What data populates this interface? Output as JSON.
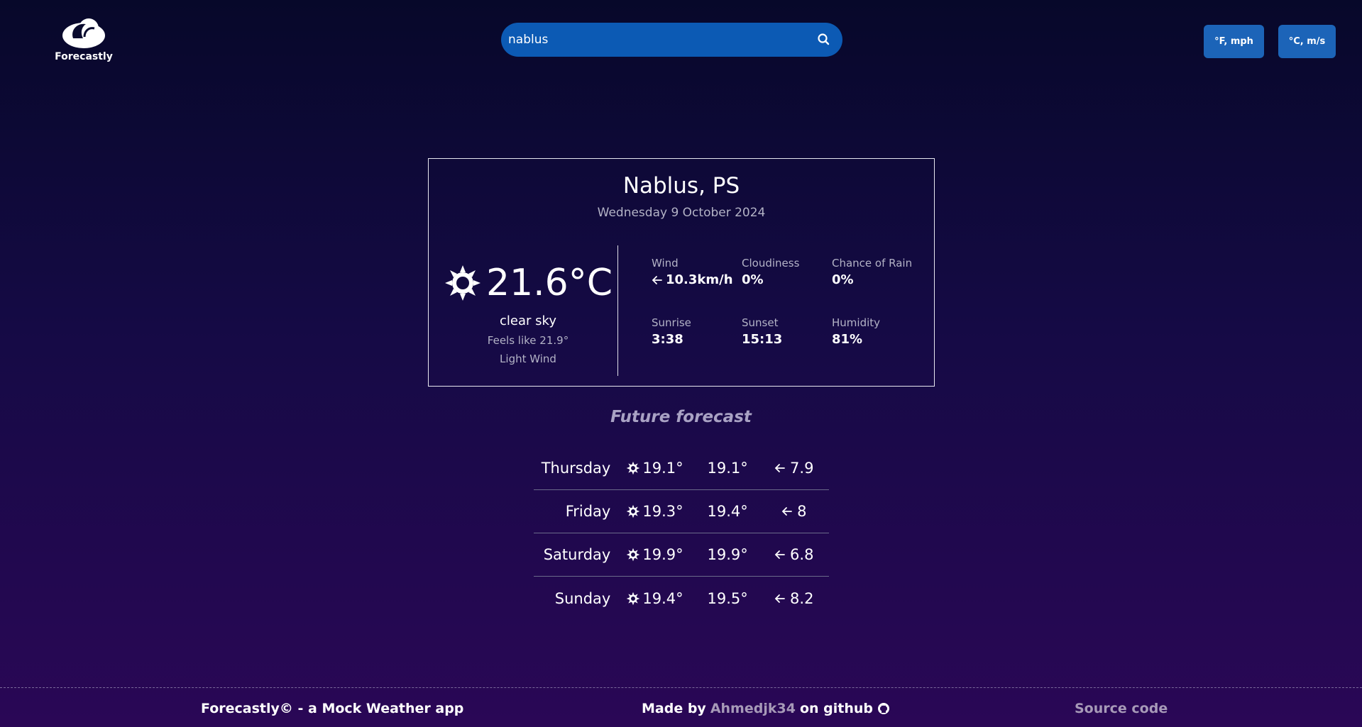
{
  "header": {
    "logo_text": "Forecastly",
    "search": {
      "value": "nablus",
      "icon": "search-icon"
    },
    "units": {
      "imperial_label": "°F, mph",
      "metric_label": "°C, m/s"
    }
  },
  "current": {
    "city": "Nablus, PS",
    "date": "Wednesday 9 October 2024",
    "icon": "sun-icon",
    "temperature": "21.6°C",
    "description": "clear sky",
    "feels_like": "Feels like 21.9°",
    "wind_text": "Light Wind",
    "stats": {
      "wind": {
        "label": "Wind",
        "value": "10.3km/h",
        "icon": "arrow-left-icon"
      },
      "cloudiness": {
        "label": "Cloudiness",
        "value": "0%"
      },
      "chance_of_rain": {
        "label": "Chance of Rain",
        "value": "0%"
      },
      "sunrise": {
        "label": "Sunrise",
        "value": "3:38"
      },
      "sunset": {
        "label": "Sunset",
        "value": "15:13"
      },
      "humidity": {
        "label": "Humidity",
        "value": "81%"
      }
    }
  },
  "forecast": {
    "title": "Future forecast",
    "days": [
      {
        "day": "Thursday",
        "min": "19.1°",
        "max": "19.1°",
        "wind": "7.9"
      },
      {
        "day": "Friday",
        "min": "19.3°",
        "max": "19.4°",
        "wind": "8"
      },
      {
        "day": "Saturday",
        "min": "19.9°",
        "max": "19.9°",
        "wind": "6.8"
      },
      {
        "day": "Sunday",
        "min": "19.4°",
        "max": "19.5°",
        "wind": "8.2"
      }
    ]
  },
  "footer": {
    "left": "Forecastly© - a Mock Weather app",
    "made_by": "Made by",
    "author": "Ahmedjk34",
    "on_github": "on github",
    "source": "Source code"
  },
  "colors": {
    "search_bg": "#0c5ab4",
    "unit_button_bg": "#1c64b8",
    "muted_text": "#b3b3c6",
    "link_text": "#a79ab8"
  }
}
